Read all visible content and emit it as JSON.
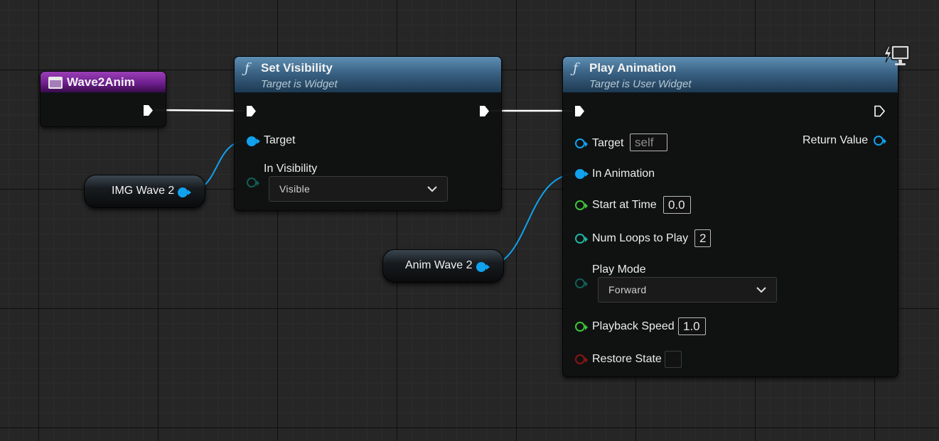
{
  "event_node": {
    "title": "Wave2Anim",
    "icon": "widget-event-icon",
    "color": "#7a2a9c"
  },
  "set_visibility": {
    "icon": "function-icon",
    "fn_glyph": "ƒ",
    "title": "Set Visibility",
    "subtitle": "Target is Widget",
    "target_label": "Target",
    "in_visibility_label": "In Visibility",
    "in_visibility_value": "Visible"
  },
  "play_animation": {
    "icon": "function-icon",
    "fn_glyph": "ƒ",
    "title": "Play Animation",
    "subtitle": "Target is User Widget",
    "target_label": "Target",
    "target_value": "self",
    "return_value_label": "Return Value",
    "in_animation_label": "In Animation",
    "start_at_time_label": "Start at Time",
    "start_at_time_value": "0.0",
    "num_loops_label": "Num Loops to Play",
    "num_loops_value": "2",
    "play_mode_label": "Play Mode",
    "play_mode_value": "Forward",
    "playback_speed_label": "Playback Speed",
    "playback_speed_value": "1.0",
    "restore_state_label": "Restore State",
    "restore_state_checked": false,
    "client_icon": "client-only-monitor-icon"
  },
  "variables": {
    "img_wave": {
      "label": "IMG Wave 2"
    },
    "anim_wave": {
      "label": "Anim Wave 2"
    }
  },
  "colors": {
    "object_pin": "#10a2ee",
    "float_pin": "#3fc33a",
    "int_pin": "#20b3a0",
    "bool_pin": "#8a1414",
    "exec_wire": "#ffffff",
    "function_header": "#3a6284"
  }
}
